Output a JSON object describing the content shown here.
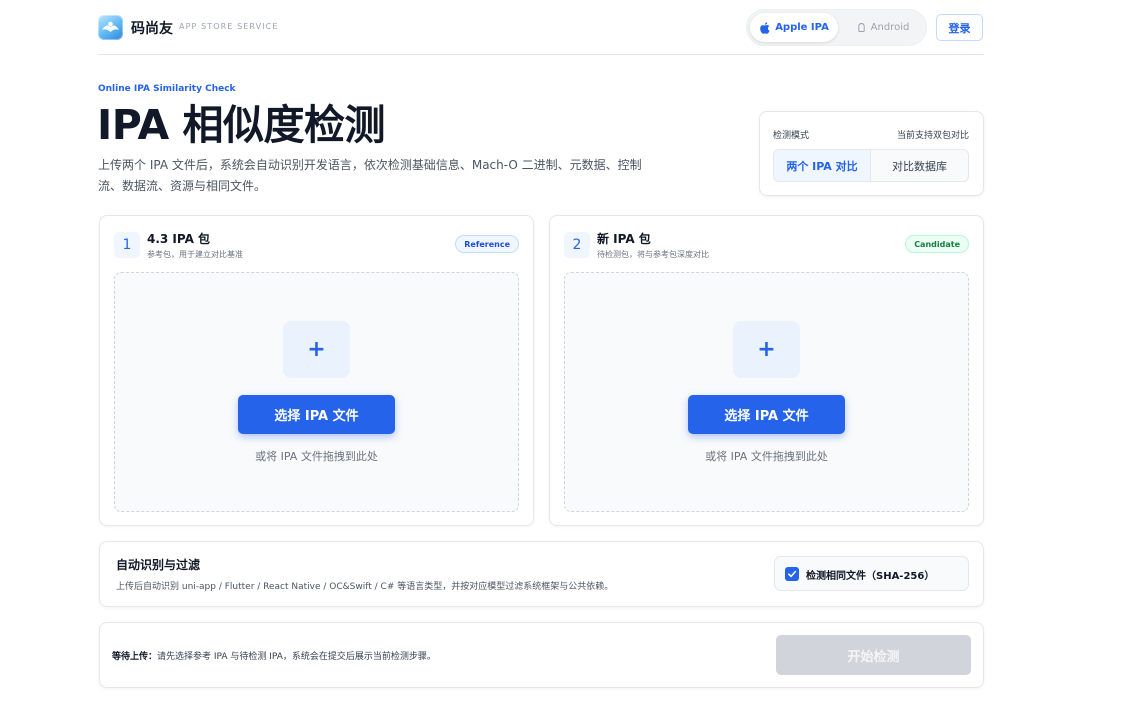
{
  "header": {
    "brand_name": "码尚友",
    "brand_sub": "APP STORE SERVICE",
    "platforms": {
      "apple_label": "Apple IPA",
      "android_label": "Android",
      "active": "Apple IPA"
    },
    "login_label": "登录"
  },
  "hero": {
    "eyebrow": "Online IPA Similarity Check",
    "title": "IPA 相似度检测",
    "description": "上传两个 IPA 文件后，系统会自动识别开发语言，依次检测基础信息、Mach-O 二进制、元数据、控制流、数据流、资源与相同文件。"
  },
  "mode": {
    "label": "检测模式",
    "hint": "当前支持双包对比",
    "options": [
      "两个 IPA 对比",
      "对比数据库"
    ],
    "selected": "两个 IPA 对比"
  },
  "panels": [
    {
      "number": "1",
      "title": "4.3 IPA 包",
      "subtitle": "参考包，用于建立对比基准",
      "tag": "Reference",
      "plus": "+",
      "button_label": "选择 IPA 文件",
      "drop_hint": "或将 IPA 文件拖拽到此处"
    },
    {
      "number": "2",
      "title": "新 IPA 包",
      "subtitle": "待检测包，将与参考包深度对比",
      "tag": "Candidate",
      "plus": "+",
      "button_label": "选择 IPA 文件",
      "drop_hint": "或将 IPA 文件拖拽到此处"
    }
  ],
  "auto": {
    "title": "自动识别与过滤",
    "description": "上传后自动识别 uni-app / Flutter / React Native / OC&Swift / C# 等语言类型，并按对应模型过滤系统框架与公共依赖。",
    "checkbox_label": "检测相同文件（SHA-256）",
    "checkbox_checked": true
  },
  "status": {
    "label": "等待上传：",
    "message": "请先选择参考 IPA 与待检测 IPA，系统会在提交后展示当前检测步骤。",
    "start_label": "开始检测",
    "start_enabled": false
  },
  "colors": {
    "accent": "#2563eb",
    "reference_tag": "#1d4ed8",
    "candidate_tag": "#15803d",
    "disabled_button": "#d1d5db"
  }
}
